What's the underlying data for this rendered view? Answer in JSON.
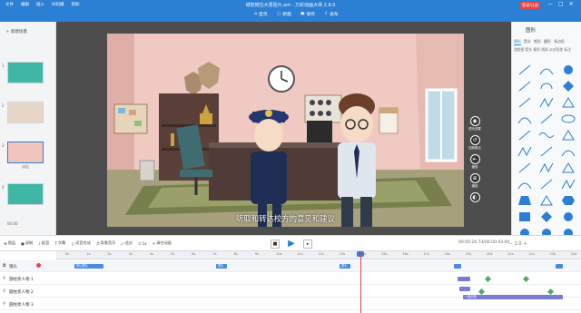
{
  "titlebar": {
    "menu": [
      "文件",
      "编辑",
      "插入",
      "扫码播",
      "帮助"
    ],
    "document_title": "城管岗位大冒险片.am - 万彩动画大师 2.8.0",
    "actions": [
      {
        "icon": "home-icon",
        "label": "首页"
      },
      {
        "icon": "new-file-icon",
        "label": "新建"
      },
      {
        "icon": "save-icon",
        "label": "保存"
      },
      {
        "icon": "publish-icon",
        "label": "发布"
      }
    ],
    "login_label": "登录/注册",
    "window_controls": [
      "—",
      "□",
      "✕"
    ]
  },
  "left_panel": {
    "new_scene_label": "新建场景",
    "scenes": [
      {
        "num": "1",
        "label": "",
        "color": "#3fb6a6"
      },
      {
        "num": "2",
        "label": "",
        "color": "#e8d6c6"
      },
      {
        "num": "3",
        "label": "派出",
        "color": "#f1c4bd"
      },
      {
        "num": "4",
        "label": "",
        "color": "#3fb6a6"
      }
    ],
    "scene_time": "00:00"
  },
  "stage": {
    "subtitle": "听取和转达校方的意见和建议"
  },
  "float_tools": [
    {
      "icon": "camera-icon",
      "label": "镜头设置"
    },
    {
      "icon": "rotate-icon",
      "label": "回到原点"
    },
    {
      "icon": "reset-icon",
      "label": "缩放"
    },
    {
      "icon": "zoom-icon",
      "label": "缩放"
    },
    {
      "icon": "color-icon",
      "label": ""
    }
  ],
  "right_panel": {
    "title": "图形",
    "tabs": [
      "图形",
      "箭头",
      "矩形",
      "圆形",
      "多边形"
    ],
    "active_tab": "图形",
    "sub_items": "流程图 箭头 星形 线条 公式形状 标注",
    "shapes_count": 36
  },
  "playbar": {
    "tools": [
      {
        "icon": "layer-icon",
        "label": "图层"
      },
      {
        "icon": "record-icon",
        "label": "录制"
      },
      {
        "icon": "mic-icon",
        "label": "配音"
      },
      {
        "icon": "subtitle-icon",
        "label": "字幕"
      },
      {
        "icon": "audio-icon",
        "label": "语音合成"
      },
      {
        "icon": "bg-music-icon",
        "label": "背景音乐"
      },
      {
        "icon": "fit-icon",
        "label": "适应"
      },
      {
        "icon": "zoom-icon",
        "label": "1x"
      },
      {
        "icon": "clear-icon",
        "label": "清空动画"
      }
    ],
    "time_display": "00:00:20.73/00:00:43.00",
    "zoom_label": "1.0"
  },
  "timeline": {
    "ticks": [
      "0s",
      "1s",
      "2s",
      "3s",
      "4s",
      "5s",
      "6s",
      "7s",
      "8s",
      "9s",
      "10s",
      "11s",
      "12s",
      "13s",
      "14s",
      "15s",
      "16s",
      "17s",
      "18s",
      "19s",
      "20s",
      "21s",
      "22s",
      "23s",
      "24s"
    ],
    "tracks": [
      {
        "icon": "camera-icon",
        "label": "镜头"
      },
      {
        "icon": "person-icon",
        "label": "圆柱状人物 1"
      },
      {
        "icon": "person-icon",
        "label": "圆柱状人物 2"
      },
      {
        "icon": "person-icon",
        "label": "圆柱状人物 3"
      }
    ],
    "bars": [
      {
        "label": "默认镜头"
      },
      {
        "label": "镜头"
      },
      {
        "label": "镜头"
      },
      {
        "label": "一起出场"
      }
    ]
  }
}
